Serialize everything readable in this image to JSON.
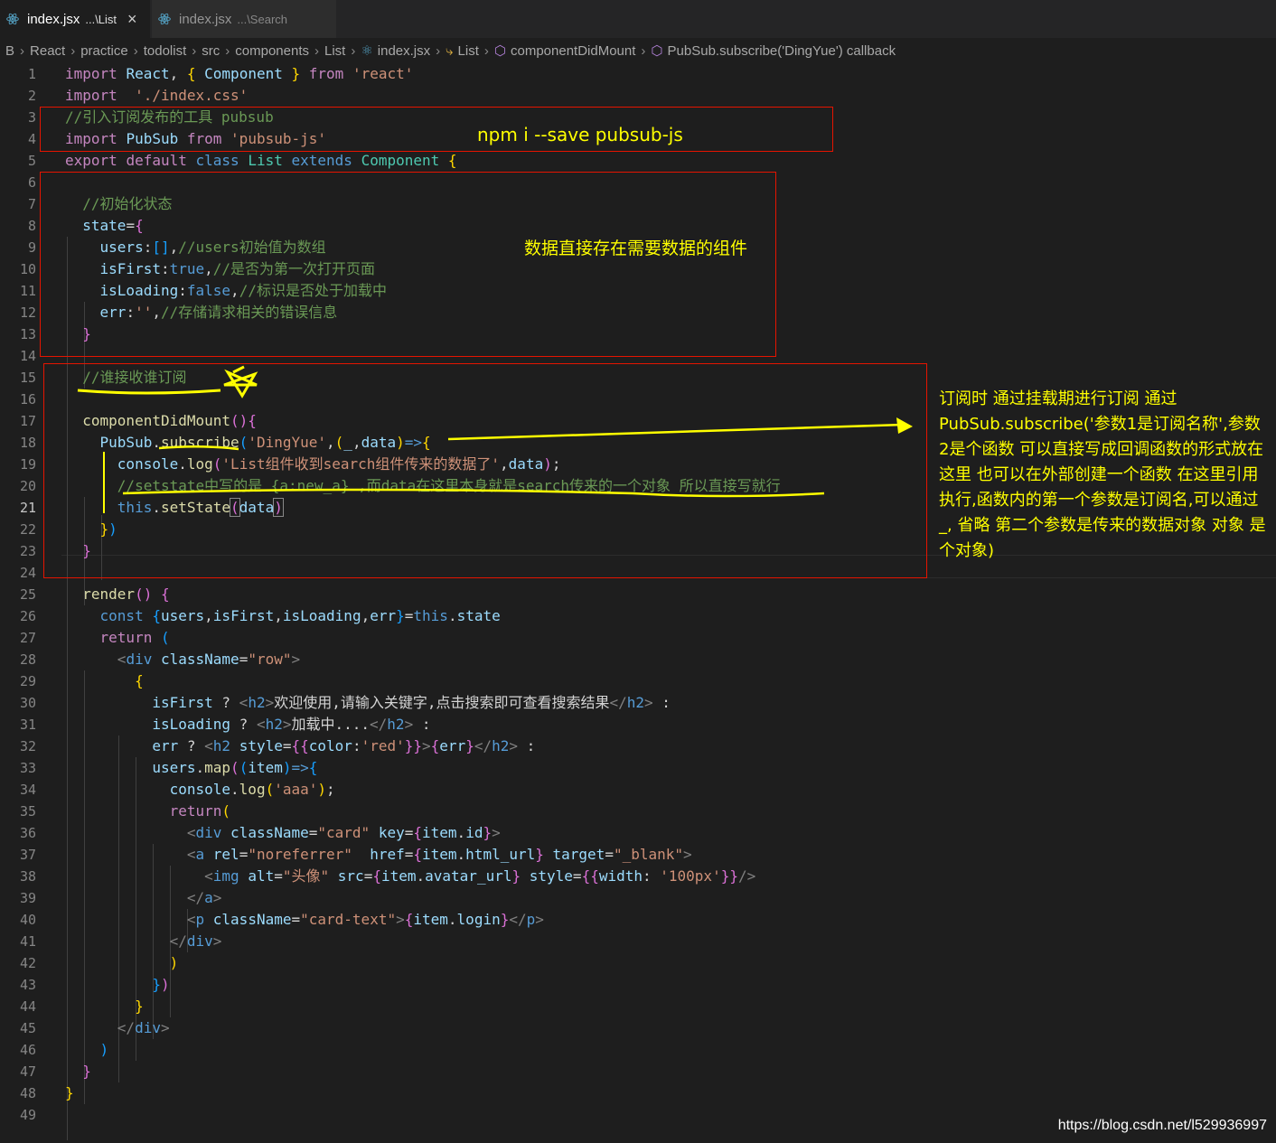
{
  "tabs": [
    {
      "file": "index.jsx",
      "path": "...\\List",
      "close": "×"
    },
    {
      "file": "index.jsx",
      "path": "...\\Search"
    }
  ],
  "breadcrumb": [
    "B",
    "React",
    "practice",
    "todolist",
    "src",
    "components",
    "List",
    "index.jsx",
    "List",
    "componentDidMount",
    "PubSub.subscribe('DingYue') callback"
  ],
  "line_numbers": [
    "1",
    "2",
    "3",
    "4",
    "5",
    "6",
    "7",
    "8",
    "9",
    "10",
    "11",
    "12",
    "13",
    "14",
    "15",
    "16",
    "17",
    "18",
    "19",
    "20",
    "21",
    "22",
    "23",
    "24",
    "25",
    "26",
    "27",
    "28",
    "29",
    "30",
    "31",
    "32",
    "33",
    "34",
    "35",
    "36",
    "37",
    "38",
    "39",
    "40",
    "41",
    "42",
    "43",
    "44",
    "45",
    "46",
    "47",
    "48",
    "49"
  ],
  "current_line": "21",
  "annotations": {
    "npm_install": "npm i --save pubsub-js",
    "state_note": "数据直接存在需要数据的组件",
    "subscribe_note": "订阅时 通过挂载期进行订阅 通过PubSub.subscribe('参数1是订阅名称',参数2是个函数 可以直接写成回调函数的形式放在这里 也可以在外部创建一个函数 在这里引用执行,函数内的第一个参数是订阅名,可以通过_, 省略  第二个参数是传来的数据对象   对象  是个对象)"
  },
  "watermark": "https://blog.csdn.net/l529936997",
  "colors": {
    "background": "#1e1e1e",
    "annotation_box": "#e51400",
    "annotation_text": "#ffff00",
    "comment": "#6a9955",
    "keyword": "#569cd6",
    "string": "#ce9178"
  }
}
